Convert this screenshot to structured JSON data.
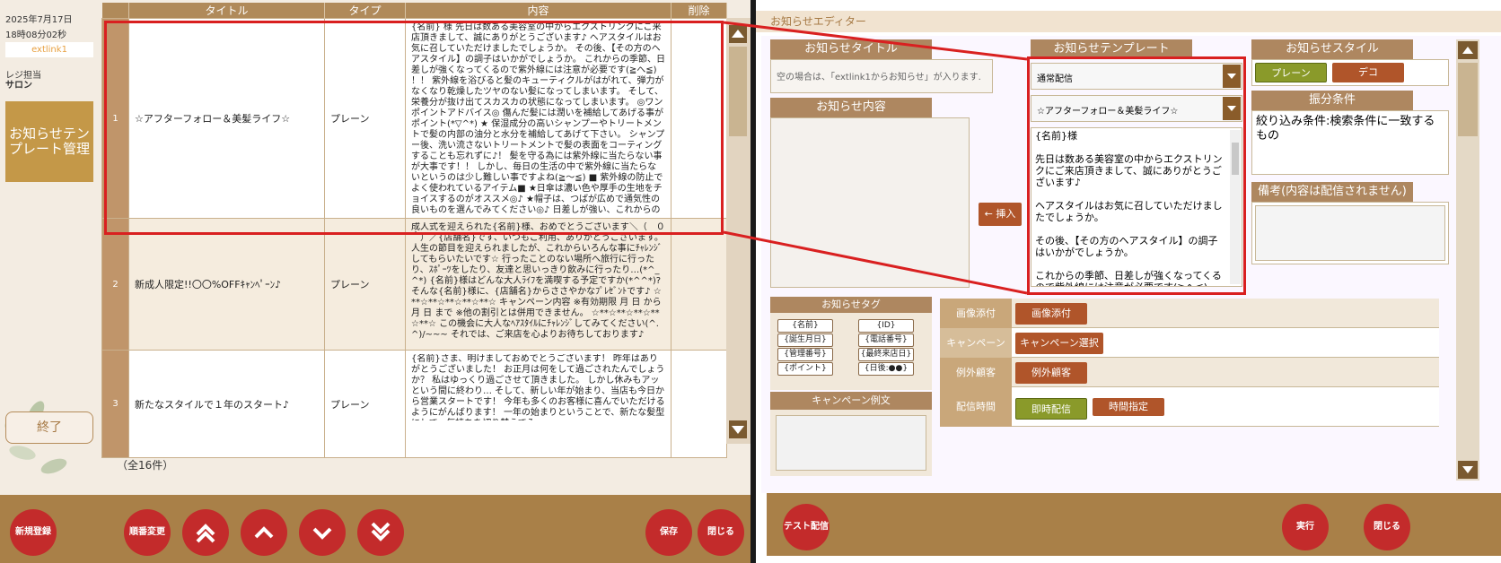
{
  "sidebar": {
    "date": "2025年7月17日",
    "time": "18時08分02秒",
    "link": "extlink1",
    "role": "レジ担当",
    "store": "サロン",
    "template_button": "お知らせテンプレート管理",
    "exit_button": "終了"
  },
  "table": {
    "headers": [
      "タイトル",
      "タイプ",
      "内容",
      "削除"
    ],
    "rows": [
      {
        "num": "1",
        "title": "☆アフターフォロー＆美髪ライフ☆",
        "type": "プレーン",
        "content": "{名前} 様 先日は数ある美容室の中からエクストリンクにご来店頂きまして、誠にありがとうございます♪ ヘアスタイルはお気に召していただけましたでしょうか。 その後、【その方のヘアスタイル】の調子はいかがでしょうか。 これからの季節、日差しが強くなってくるので紫外線には注意が必要です(≧へ≦) ！！ 紫外線を浴びると髪のキューティクルがはがれて、弾力がなくなり乾燥したツヤのない髪になってしまいます。 そして、栄養分が抜け出てスカスカの状態になってしまいます。 ◎ワンポイントアドバイス◎ 傷んだ髪には潤いを補給してあげる事がポイント(*▽^*) ★ 保湿成分の高いシャンプーやトリートメントで髪の内部の油分と水分を補給してあげて下さい。 シャンプー後、洗い流さないトリートメントで髪の表面をコーティングすることも忘れずに♪！ 髪を守る為には紫外線に当たらない事が大事です！！ しかし、毎日の生活の中で紫外線に当たらないというのは少し難しい事ですよね(≧～≦) ■ 紫外線の防止でよく使われているアイテム■ ★日傘は濃い色や厚手の生地をチョイスするのがオススメ◎♪ ★帽子は、つばが広めで通気性の良いものを選んでみてください◎♪ 日差しが強い、これからの季節に備えましょう♪ ★またのご来店を心よりお待ちしております★"
      },
      {
        "num": "2",
        "title": "新成人限定!!〇〇%OFFｷｬﾝﾍﾟｰﾝ♪",
        "type": "プレーン",
        "content": "成人式を迎えられた{名前}様、おめでとうございます＼（＾０＾）／{店舗名}です、いつもご利用、ありがとうございます。 人生の節目を迎えられましたが、これからいろんな事にﾁｬﾚﾝｼﾞしてもらいたいです☆ 行ったことのない場所へ旅行に行ったり、ｽﾎﾟｰﾂをしたり、友達と思いっきり飲みに行ったり…(*^_^*) {名前}様はどんな大人ﾗｲﾌを満喫する予定ですか(*^^*)? そんな{名前}様に、{店舗名}からささやかなﾌﾟﾚｾﾞﾝﾄです♪ ☆**☆**☆**☆**☆**☆ キャンペーン内容 ※有効期限 月 日 から 月 日 まで ※他の割引とは併用できません。 ☆**☆**☆**☆**☆**☆ この機会に大人なﾍｱｽﾀｲﾙにﾁｬﾚﾝｼﾞしてみてください(^.^)/~~~ それでは、ご来店を心よりお待ちしております♪"
      },
      {
        "num": "3",
        "title": "新たなスタイルで１年のスタート♪",
        "type": "プレーン",
        "content": "{名前}さま、明けましておめでとうございます！ 昨年はありがとうございました！ お正月は何をして過ごされたんでしょうか？ 私はゆっくり過ごさせて頂きました。 しかし休みもアッという間に終わり… そして、新しい年が始まり、当店も今日から営業スタートです！ 今年も多くのお客様に喜んでいただけるようにがんばります！ 一年の始まりということで、新たな髪型にして、気持ちを切り替えてみ"
      }
    ],
    "count": "（全16件）"
  },
  "left_footer": {
    "new": "新規登録",
    "reorder": "順番変更",
    "save": "保存",
    "close": "閉じる"
  },
  "editor": {
    "title": "お知らせエディター",
    "title_header": "お知らせタイトル",
    "title_placeholder": "空の場合は、「extlink1からお知らせ」が入ります.",
    "content_header": "お知らせ内容",
    "tag_header": "お知らせタグ",
    "tags": [
      "{名前}",
      "{ID}",
      "{誕生月日}",
      "{電話番号}",
      "{管理番号}",
      "{最終来店日}",
      "{ポイント}",
      "{日後:●●}"
    ],
    "campaign_header": "キャンペーン例文",
    "template_header": "お知らせテンプレート",
    "template_category": "通常配信",
    "template_name": "☆アフターフォロー＆美髪ライフ☆",
    "template_preview": "{名前}様\n\n先日は数ある美容室の中からエクストリンクにご来店頂きまして、誠にありがとうございます♪\n\nヘアスタイルはお気に召していただけましたでしょうか。\n\nその後、【その方のヘアスタイル】の調子はいかがでしょうか。\n\nこれからの季節、日差しが強くなってくるので紫外線には注意が必要です(≧へ≦) ！！\n\n紫外線を浴びると髪のキューティクルがはが",
    "insert_button": "← 挿入",
    "style_header": "お知らせスタイル",
    "style_plain": "プレーン",
    "style_deco": "デコ",
    "filter_header": "振分条件",
    "filter_text": "絞り込み条件:検索条件に一致するもの",
    "note_header": "備考(内容は配信されません)",
    "image_label": "画像添付",
    "image_button": "画像添付",
    "campaign_label": "キャンペーン",
    "campaign_button": "キャンペーン選択",
    "exception_label": "例外顧客",
    "exception_button": "例外顧客",
    "time_label": "配信時間",
    "time_now": "即時配信",
    "time_set": "時間指定",
    "test_button": "テスト配信",
    "run_button": "実行",
    "close_button": "閉じる"
  },
  "colors": {
    "brown": "#a98048",
    "red": "#c32b2b",
    "green": "#8a9a2a",
    "rust": "#b0552a"
  }
}
